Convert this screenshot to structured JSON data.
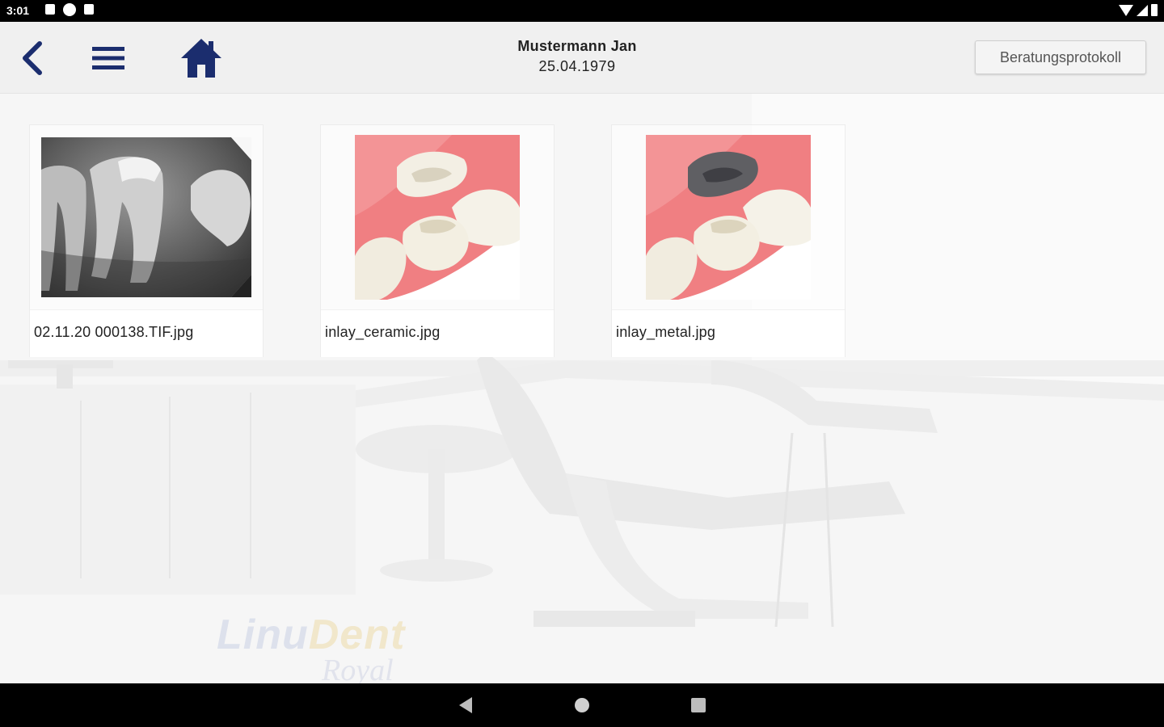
{
  "status_bar": {
    "time": "3:01",
    "left_icons": [
      "notification-icon",
      "notification-circle-icon",
      "sd-card-icon"
    ],
    "right_icons": [
      "wifi-icon",
      "cellular-signal-icon",
      "battery-icon"
    ]
  },
  "header": {
    "back_icon": "chevron-left-icon",
    "menu_icon": "hamburger-menu-icon",
    "home_icon": "home-icon",
    "patient_name": "Mustermann Jan",
    "patient_dob": "25.04.1979",
    "protocol_button_label": "Beratungsprotokoll",
    "accent_color": "#1b2d6e"
  },
  "files": [
    {
      "label": "02.11.20 000138.TIF.jpg",
      "thumbnail": "xray"
    },
    {
      "label": "inlay_ceramic.jpg",
      "thumbnail": "inlay-ceramic"
    },
    {
      "label": "inlay_metal.jpg",
      "thumbnail": "inlay-metal"
    }
  ],
  "watermark": {
    "line1_part1": "Linu",
    "line1_part2": "Dent",
    "line2": "Royal"
  },
  "nav_bar": {
    "icons": [
      "nav-back-icon",
      "nav-home-icon",
      "nav-recents-icon"
    ]
  }
}
